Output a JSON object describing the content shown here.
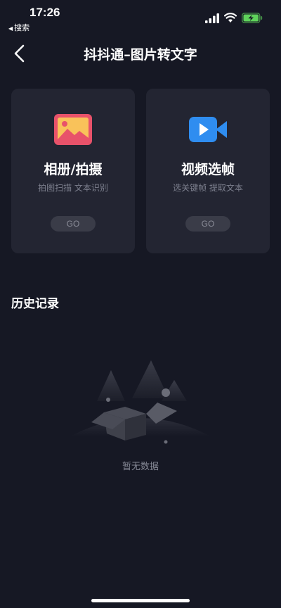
{
  "status_bar": {
    "time": "17:26",
    "back_app_label": "搜索"
  },
  "nav": {
    "title": "抖抖通–图片转文字"
  },
  "cards": [
    {
      "title": "相册/拍摄",
      "subtitle": "拍图扫描 文本识别",
      "button": "GO",
      "icon": "image-icon"
    },
    {
      "title": "视频选帧",
      "subtitle": "选关键帧 提取文本",
      "button": "GO",
      "icon": "video-icon"
    }
  ],
  "history": {
    "title": "历史记录",
    "empty_text": "暂无数据"
  },
  "colors": {
    "background": "#161824",
    "card": "#232532",
    "image_icon": "#e8526a",
    "video_icon": "#2f8df0",
    "battery": "#5fd35b"
  }
}
